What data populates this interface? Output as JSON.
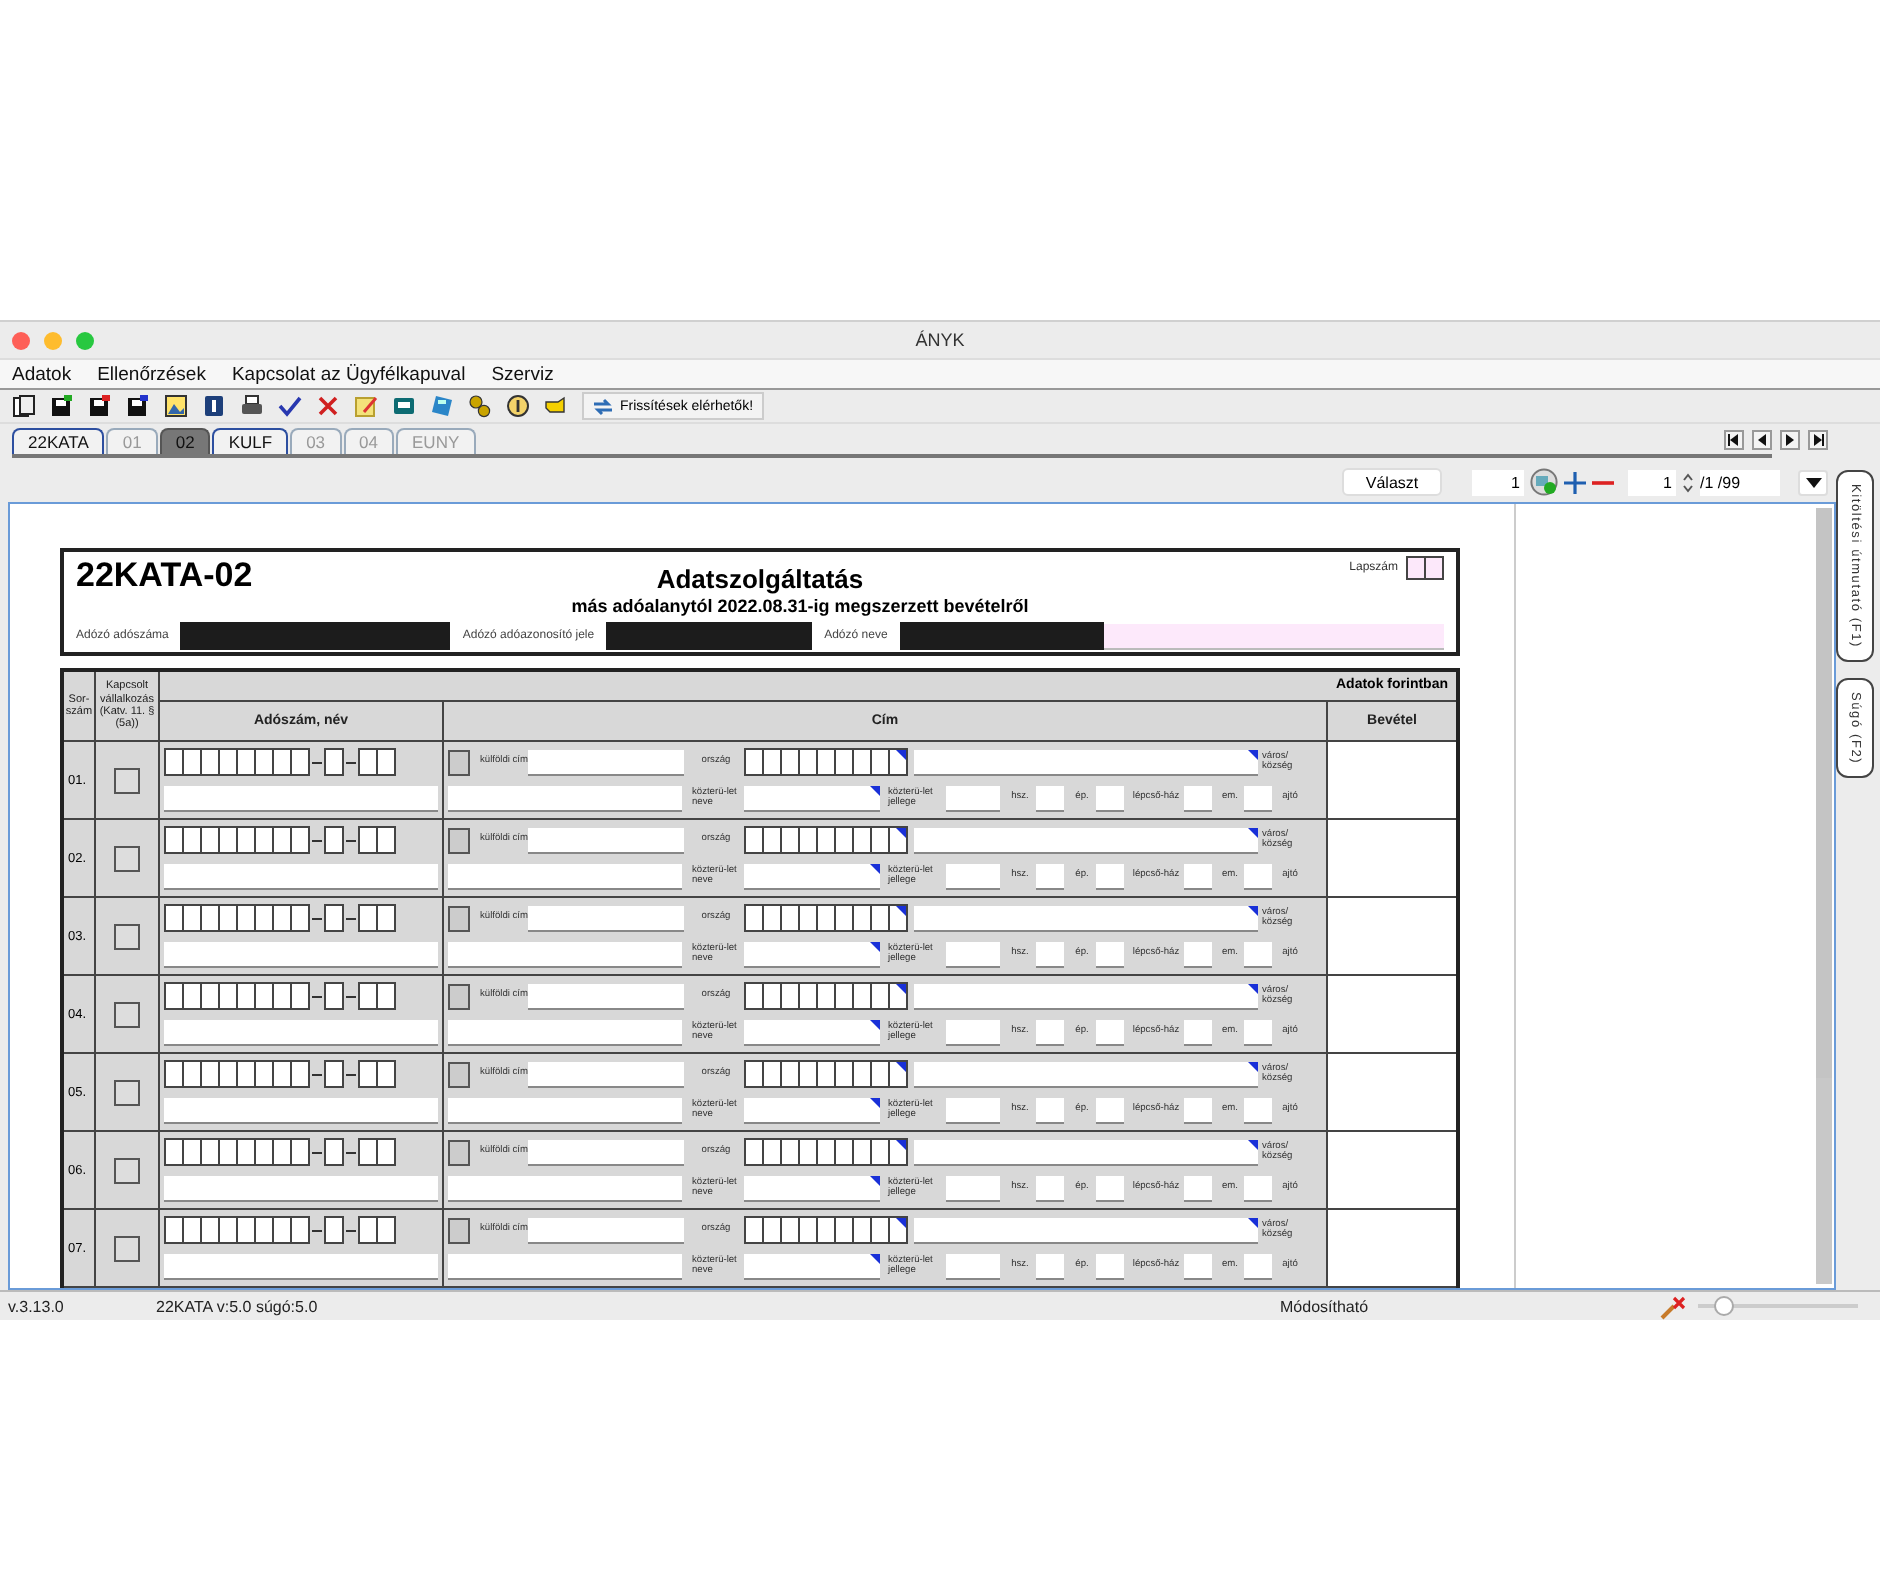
{
  "window": {
    "title": "ÁNYK"
  },
  "menu": [
    "Adatok",
    "Ellenőrzések",
    "Kapcsolat az Ügyfélkapuval",
    "Szerviz"
  ],
  "toolbar": {
    "update_button": "Frissítések elérhetők!"
  },
  "tabs": [
    {
      "label": "22KATA",
      "selected": false,
      "disabled": false
    },
    {
      "label": "01",
      "selected": false,
      "disabled": true
    },
    {
      "label": "02",
      "selected": true,
      "disabled": false
    },
    {
      "label": "KULF",
      "selected": false,
      "disabled": false
    },
    {
      "label": "03",
      "selected": false,
      "disabled": true
    },
    {
      "label": "04",
      "selected": false,
      "disabled": true
    },
    {
      "label": "EUNY",
      "selected": false,
      "disabled": true
    }
  ],
  "navigator": {
    "select_button": "Választ",
    "page_field": "1",
    "count_field": "1",
    "total": "/1 /99"
  },
  "side_tabs": [
    "Kitöltési útmutató (F1)",
    "Súgó (F2)"
  ],
  "form": {
    "code": "22KATA-02",
    "title": "Adatszolgáltatás",
    "subtitle": "más adóalanytól 2022.08.31-ig megszerzett bevételről",
    "sheet_label": "Lapszám",
    "taxpayer_labels": [
      "Adózó adószáma",
      "Adózó adóazonosító jele",
      "Adózó neve"
    ],
    "currency_note": "Adatok forintban",
    "columns": [
      "Sor-szám",
      "Kapcsolt vállalkozás (Katv. 11. § (5a))",
      "Adószám,  név",
      "Cím",
      "Bevétel"
    ],
    "rows": [
      {
        "number": "01.",
        "checked": false,
        "foreign_checked": false,
        "address_labels": {
          "foreign": "külföldi cím",
          "country": "ország",
          "city": "város/ község",
          "street_name": "közterü-let neve",
          "street_type": "közterü-let jellege",
          "number": "hsz.",
          "building": "ép.",
          "staircase": "lépcső-ház",
          "floor": "em.",
          "door": "ajtó"
        }
      },
      {
        "number": "02.",
        "checked": false,
        "foreign_checked": false,
        "address_labels": {
          "foreign": "külföldi cím",
          "country": "ország",
          "city": "város/ község",
          "street_name": "közterü-let neve",
          "street_type": "közterü-let jellege",
          "number": "hsz.",
          "building": "ép.",
          "staircase": "lépcső-ház",
          "floor": "em.",
          "door": "ajtó"
        }
      },
      {
        "number": "03.",
        "checked": false,
        "foreign_checked": false,
        "address_labels": {
          "foreign": "külföldi cím",
          "country": "ország",
          "city": "város/ község",
          "street_name": "közterü-let neve",
          "street_type": "közterü-let jellege",
          "number": "hsz.",
          "building": "ép.",
          "staircase": "lépcső-ház",
          "floor": "em.",
          "door": "ajtó"
        }
      },
      {
        "number": "04.",
        "checked": false,
        "foreign_checked": false,
        "address_labels": {
          "foreign": "külföldi cím",
          "country": "ország",
          "city": "város/ község",
          "street_name": "közterü-let neve",
          "street_type": "közterü-let jellege",
          "number": "hsz.",
          "building": "ép.",
          "staircase": "lépcső-ház",
          "floor": "em.",
          "door": "ajtó"
        }
      },
      {
        "number": "05.",
        "checked": false,
        "foreign_checked": false,
        "address_labels": {
          "foreign": "külföldi cím",
          "country": "ország",
          "city": "város/ község",
          "street_name": "közterü-let neve",
          "street_type": "közterü-let jellege",
          "number": "hsz.",
          "building": "ép.",
          "staircase": "lépcső-ház",
          "floor": "em.",
          "door": "ajtó"
        }
      },
      {
        "number": "06.",
        "checked": false,
        "foreign_checked": false,
        "address_labels": {
          "foreign": "külföldi cím",
          "country": "ország",
          "city": "város/ község",
          "street_name": "közterü-let neve",
          "street_type": "közterü-let jellege",
          "number": "hsz.",
          "building": "ép.",
          "staircase": "lépcső-ház",
          "floor": "em.",
          "door": "ajtó"
        }
      },
      {
        "number": "07.",
        "checked": false,
        "foreign_checked": false,
        "address_labels": {
          "foreign": "külföldi cím",
          "country": "ország",
          "city": "város/ község",
          "street_name": "közterü-let neve",
          "street_type": "közterü-let jellege",
          "number": "hsz.",
          "building": "ép.",
          "staircase": "lépcső-ház",
          "floor": "em.",
          "door": "ajtó"
        }
      }
    ]
  },
  "status_bar": {
    "version": "v.3.13.0",
    "form_version": "22KATA v:5.0 súgó:5.0",
    "mode": "Módosítható",
    "zoom": {
      "level": 0.12
    }
  }
}
